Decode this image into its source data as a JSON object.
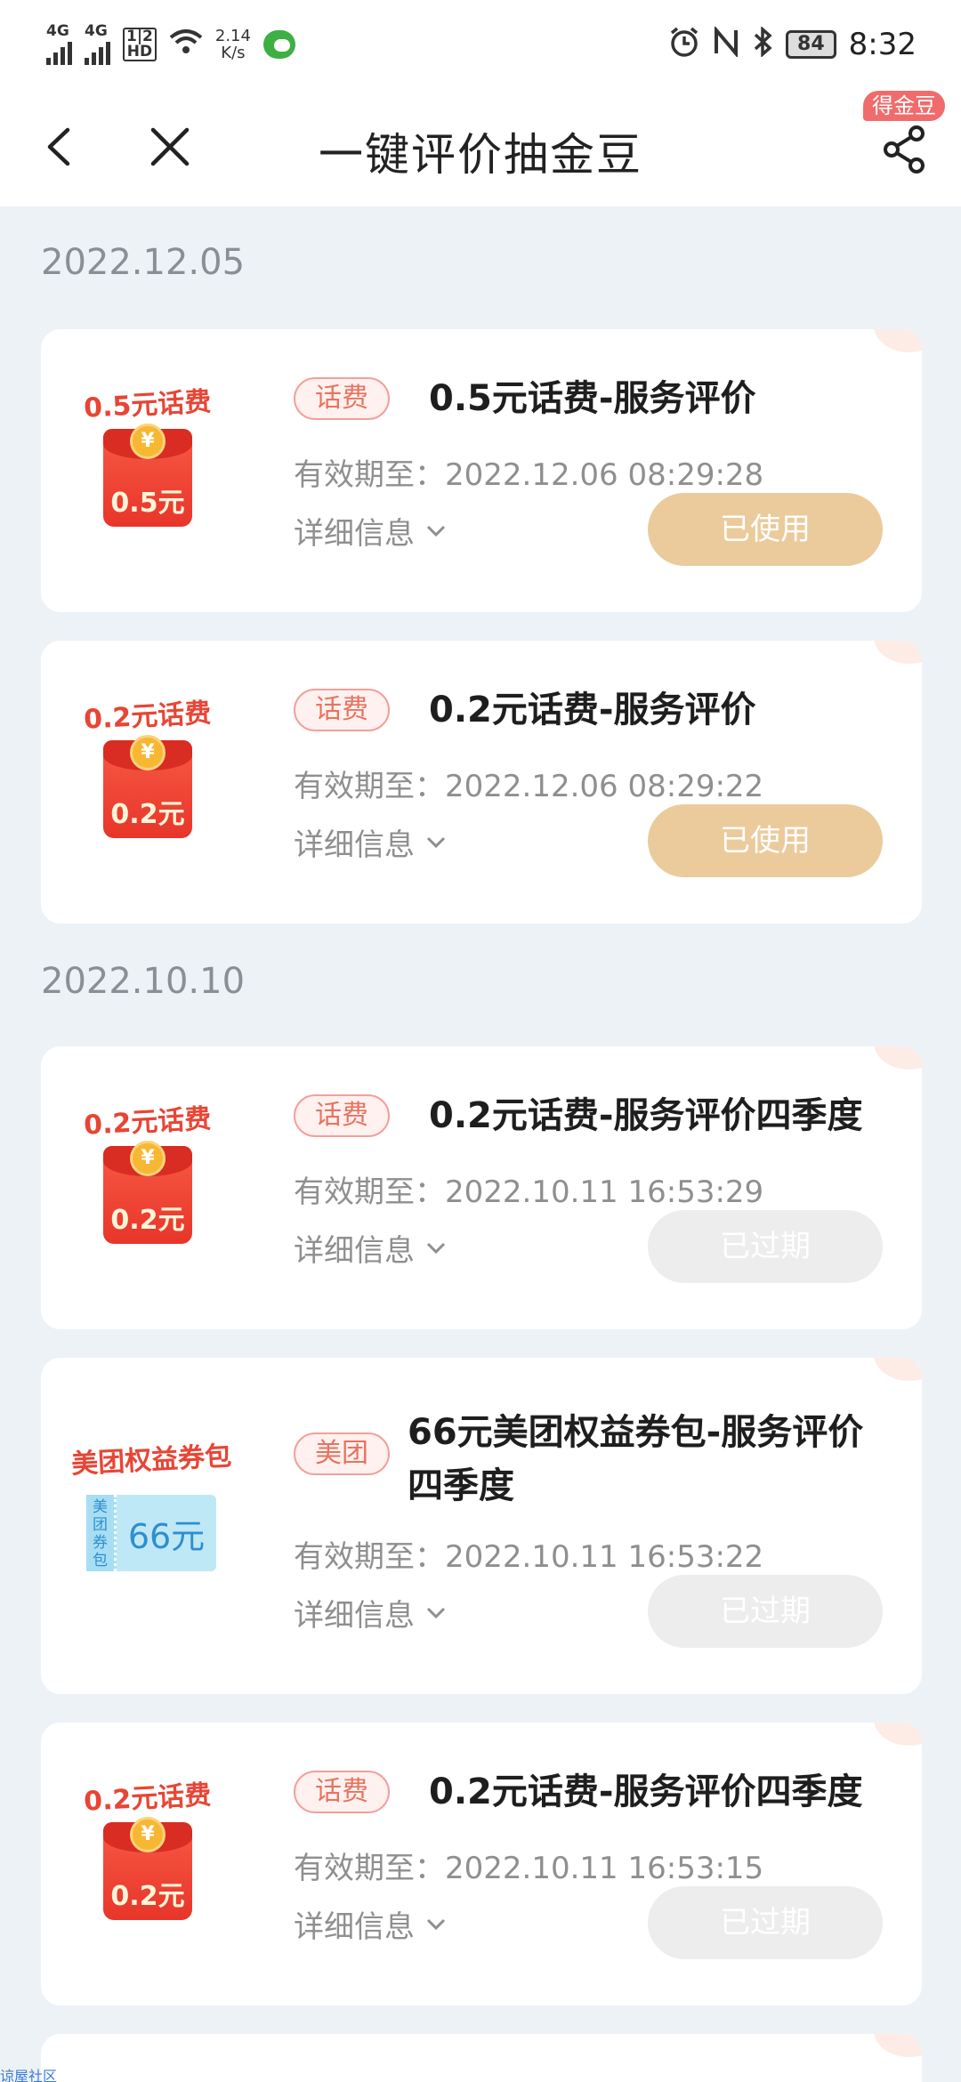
{
  "status_bar": {
    "signal1": "4G",
    "signal2": "4G",
    "hd_top": "1|2",
    "hd_bottom": "HD",
    "speed_value": "2.14",
    "speed_unit": "K/s",
    "battery": "84",
    "time": "8:32"
  },
  "nav": {
    "title": "一键评价抽金豆",
    "badge": "得金豆"
  },
  "groups": [
    {
      "date": "2022.12.05",
      "items": [
        {
          "prize_label": "0.5元话费",
          "prize_amount": "0.5元",
          "tag": "话费",
          "title": "0.5元话费-服务评价",
          "title2": "",
          "expiry": "有效期至：2022.12.06 08:29:28",
          "detail": "详细信息",
          "status": "已使用"
        },
        {
          "prize_label": "0.2元话费",
          "prize_amount": "0.2元",
          "tag": "话费",
          "title": "0.2元话费-服务评价",
          "title2": "",
          "expiry": "有效期至：2022.12.06 08:29:22",
          "detail": "详细信息",
          "status": "已使用"
        }
      ]
    },
    {
      "date": "2022.10.10",
      "items": [
        {
          "prize_label": "0.2元话费",
          "prize_amount": "0.2元",
          "tag": "话费",
          "title": "0.2元话费-服务评价四季度",
          "title2": "",
          "expiry": "有效期至：2022.10.11 16:53:29",
          "detail": "详细信息",
          "status": "已过期"
        },
        {
          "prize_label": "美团权益券包",
          "voucher_side": "美团券包",
          "prize_amount": "66元",
          "tag": "美团",
          "title": "66元美团权益券包-服务评价",
          "title2": "四季度",
          "expiry": "有效期至：2022.10.11 16:53:22",
          "detail": "详细信息",
          "status": "已过期"
        },
        {
          "prize_label": "0.2元话费",
          "prize_amount": "0.2元",
          "tag": "话费",
          "title": "0.2元话费-服务评价四季度",
          "title2": "",
          "expiry": "有效期至：2022.10.11 16:53:15",
          "detail": "详细信息",
          "status": "已过期"
        }
      ]
    }
  ],
  "watermark": "谅屋社区",
  "colors": {
    "accent_red": "#e84535",
    "used_button": "#ebcb9c",
    "expired_button": "#ededed",
    "page_background": "#edf2f7"
  }
}
